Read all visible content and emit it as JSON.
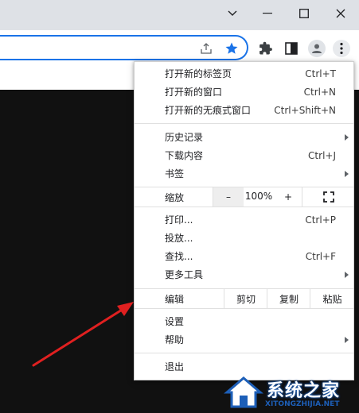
{
  "menu": {
    "items": [
      {
        "label": "打开新的标签页",
        "shortcut": "Ctrl+T"
      },
      {
        "label": "打开新的窗口",
        "shortcut": "Ctrl+N"
      },
      {
        "label": "打开新的无痕式窗口",
        "shortcut": "Ctrl+Shift+N"
      },
      {
        "label": "历史记录",
        "shortcut": ""
      },
      {
        "label": "下载内容",
        "shortcut": "Ctrl+J"
      },
      {
        "label": "书签",
        "shortcut": ""
      },
      {
        "label": "打印...",
        "shortcut": "Ctrl+P"
      },
      {
        "label": "投放...",
        "shortcut": ""
      },
      {
        "label": "查找...",
        "shortcut": "Ctrl+F"
      },
      {
        "label": "更多工具",
        "shortcut": ""
      },
      {
        "label": "设置",
        "shortcut": ""
      },
      {
        "label": "帮助",
        "shortcut": ""
      },
      {
        "label": "退出",
        "shortcut": ""
      }
    ],
    "zoom": {
      "label": "缩放",
      "minus": "–",
      "value": "100%",
      "plus": "+"
    },
    "edit": {
      "label": "编辑",
      "cut": "剪切",
      "copy": "复制",
      "paste": "粘贴"
    }
  },
  "watermark": {
    "title": "系统之家",
    "subtitle": "XITONGZHIJIA.NET"
  },
  "colors": {
    "accent": "#1a73e8",
    "annotation_arrow": "#e02020"
  }
}
